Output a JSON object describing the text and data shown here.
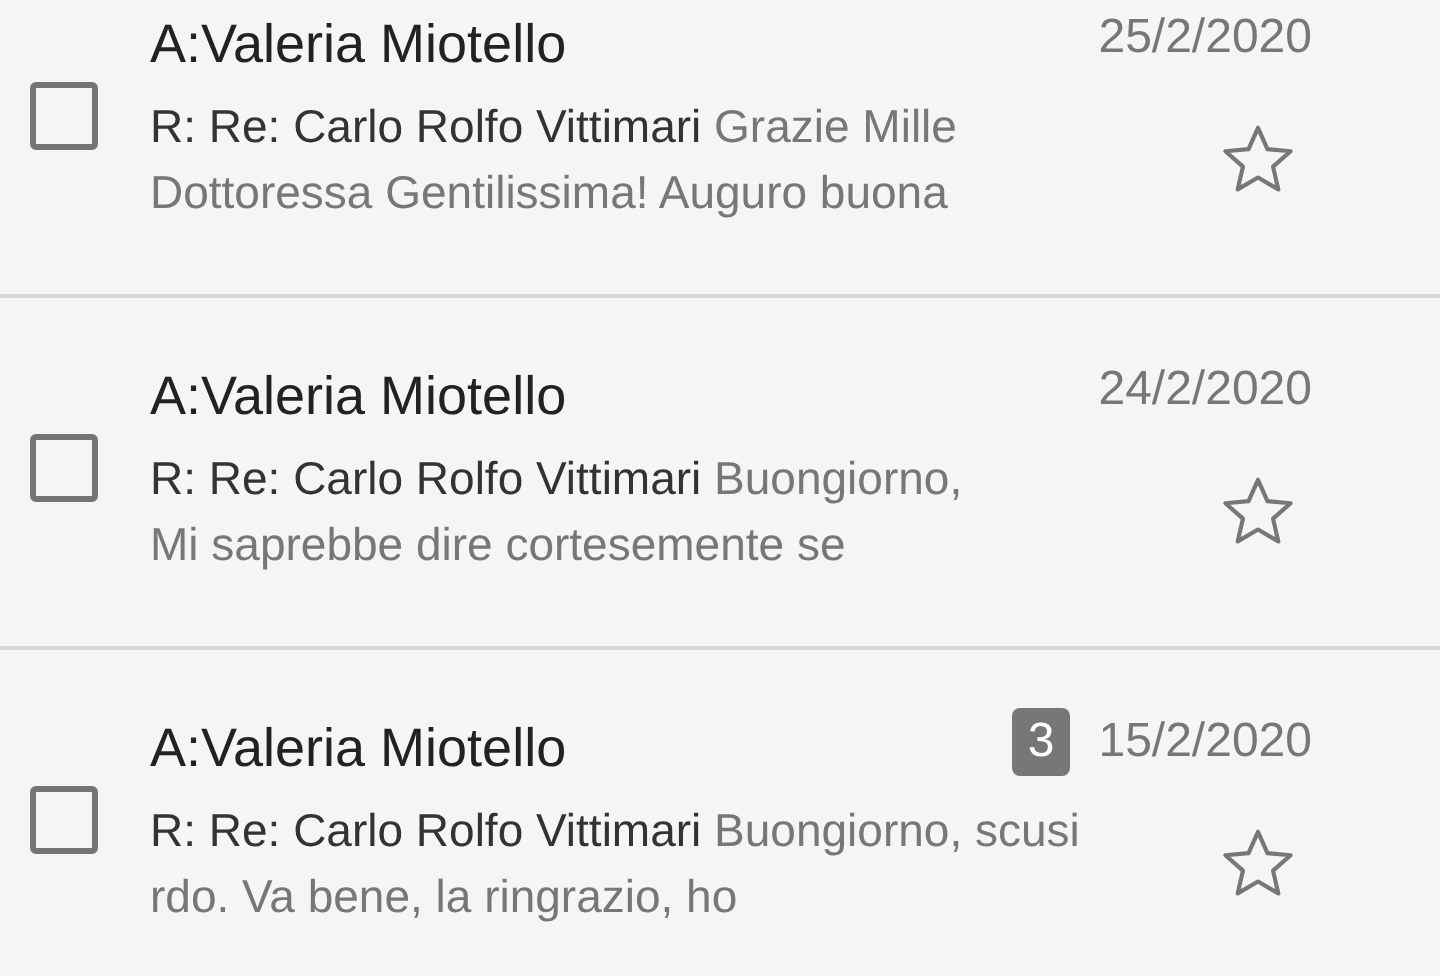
{
  "messages": [
    {
      "recipient": "A:Valeria Miotello",
      "date": "25/2/2020",
      "checked": false,
      "starred": false,
      "subject": "R: Re: Carlo Rolfo Vittimari",
      "preview_line_1": "Grazie Mille",
      "preview_line_2": "Dottoressa Gentilissima! Auguro buona"
    },
    {
      "recipient": "A:Valeria Miotello",
      "date": "24/2/2020",
      "checked": false,
      "starred": false,
      "subject": "R: Re: Carlo Rolfo Vittimari",
      "preview_line_1": "Buongiorno,",
      "preview_line_2": "Mi saprebbe dire cortesemente se"
    },
    {
      "recipient": "A:Valeria Miotello",
      "date": "15/2/2020",
      "thread_count": "3",
      "checked": false,
      "starred": false,
      "subject": "R: Re: Carlo Rolfo Vittimari",
      "preview_line_1": "Buongiorno, scusi",
      "preview_line_2": "rdo. Va bene, la ringrazio, ho"
    }
  ]
}
